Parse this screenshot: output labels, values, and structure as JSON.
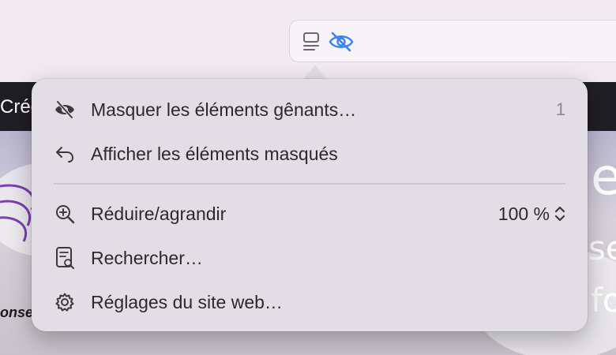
{
  "page_behind": {
    "topbar_text": "Créc",
    "hero_side_text": "onse",
    "hero_letters": [
      "e",
      "se",
      "fo"
    ]
  },
  "toolbar": {
    "icons": [
      "reader-mode-icon",
      "hide-distractions-eye-icon"
    ]
  },
  "menu": {
    "items": [
      {
        "label": "Masquer les éléments gênants…",
        "icon": "eye-slash-icon",
        "trailing": "1"
      },
      {
        "label": "Afficher les éléments masqués",
        "icon": "undo-arrow-icon"
      },
      {
        "label": "Réduire/agrandir",
        "icon": "magnifier-plus-icon",
        "zoom_value": "100 %"
      },
      {
        "label": "Rechercher…",
        "icon": "find-in-page-icon"
      },
      {
        "label": "Réglages du site web…",
        "icon": "gear-icon"
      }
    ]
  },
  "colors": {
    "accent_eye": "#3b82f6",
    "popover_bg": "#e3dde6",
    "text": "#2a2a2e"
  }
}
